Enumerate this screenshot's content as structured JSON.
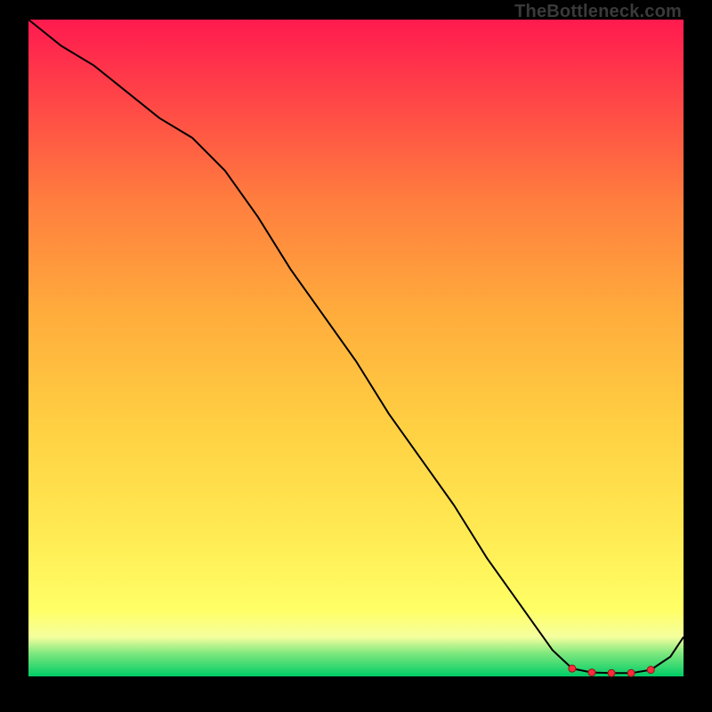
{
  "attribution": "TheBottleneck.com",
  "chart_data": {
    "type": "line",
    "title": "",
    "xlabel": "",
    "ylabel": "",
    "xlim": [
      0,
      100
    ],
    "ylim": [
      0,
      100
    ],
    "grid": false,
    "legend": false,
    "background": "red-yellow-green vertical gradient (green at bottom)",
    "series": [
      {
        "name": "curve",
        "color": "#000000",
        "x": [
          0,
          5,
          10,
          15,
          20,
          25,
          30,
          35,
          40,
          45,
          50,
          55,
          60,
          65,
          70,
          75,
          80,
          83,
          86,
          89,
          92,
          95,
          98,
          100
        ],
        "y": [
          100,
          96,
          93,
          89,
          85,
          82,
          77,
          70,
          62,
          55,
          48,
          40,
          33,
          26,
          18,
          11,
          4,
          1.2,
          0.6,
          0.5,
          0.5,
          1.0,
          3.0,
          6.0
        ],
        "marker": [
          false,
          false,
          false,
          false,
          false,
          false,
          false,
          false,
          false,
          false,
          false,
          false,
          false,
          false,
          false,
          false,
          false,
          true,
          true,
          true,
          true,
          true,
          false,
          false
        ]
      }
    ],
    "marker_style": {
      "shape": "circle",
      "fill": "#ff2a3a",
      "stroke": "#8b1a1a",
      "radius_px": 4
    }
  }
}
